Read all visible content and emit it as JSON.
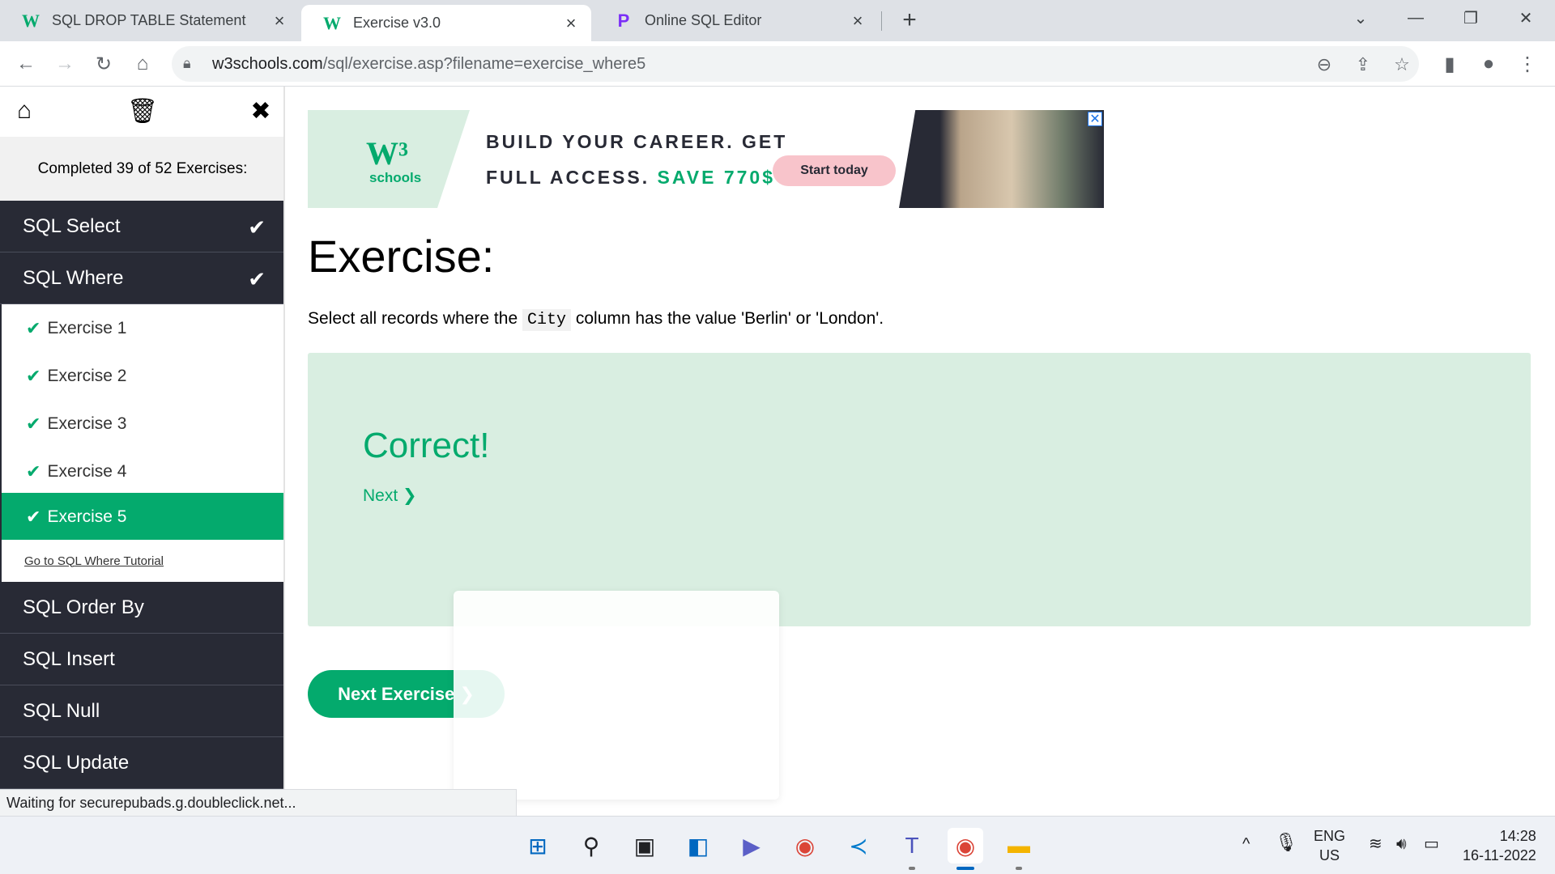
{
  "browser": {
    "tabs": [
      {
        "title": "SQL DROP TABLE Statement",
        "favicon": "w3schools-icon"
      },
      {
        "title": "Exercise v3.0",
        "favicon": "w3schools-icon",
        "active": true
      },
      {
        "title": "Online SQL Editor",
        "favicon": "programiz-icon"
      }
    ],
    "url_host": "w3schools.com",
    "url_path": "/sql/exercise.asp?filename=exercise_where5",
    "status": "Waiting for securepubads.g.doubleclick.net..."
  },
  "sidebar": {
    "completed": "Completed 39 of 52 Exercises:",
    "categories_top": [
      {
        "label": "SQL Select",
        "done": true
      },
      {
        "label": "SQL Where",
        "done": true
      }
    ],
    "exercises": [
      {
        "label": "Exercise 1"
      },
      {
        "label": "Exercise 2"
      },
      {
        "label": "Exercise 3"
      },
      {
        "label": "Exercise 4"
      },
      {
        "label": "Exercise 5",
        "active": true
      }
    ],
    "tutorial_link": "Go to SQL Where Tutorial",
    "categories_bottom": [
      {
        "label": "SQL Order By"
      },
      {
        "label": "SQL Insert"
      },
      {
        "label": "SQL Null"
      },
      {
        "label": "SQL Update"
      }
    ]
  },
  "ad": {
    "logo_text": "schools",
    "line1": "BUILD YOUR CAREER. GET",
    "line2_a": "FULL ACCESS.",
    "line2_b": "SAVE 770$",
    "button": "Start today"
  },
  "main": {
    "heading": "Exercise:",
    "prompt_before": "Select all records where the",
    "prompt_code": "City",
    "prompt_after": "column has the value 'Berlin' or 'London'.",
    "result_title": "Correct!",
    "result_next": "Next ❯",
    "next_exercise": "Next Exercise ❯"
  },
  "taskbar": {
    "lang_top": "ENG",
    "lang_bottom": "US",
    "time": "14:28",
    "date": "16-11-2022"
  },
  "colors": {
    "accent": "#04aa6d",
    "sidebar_dark": "#282a35",
    "result_bg": "#d9eee1"
  }
}
